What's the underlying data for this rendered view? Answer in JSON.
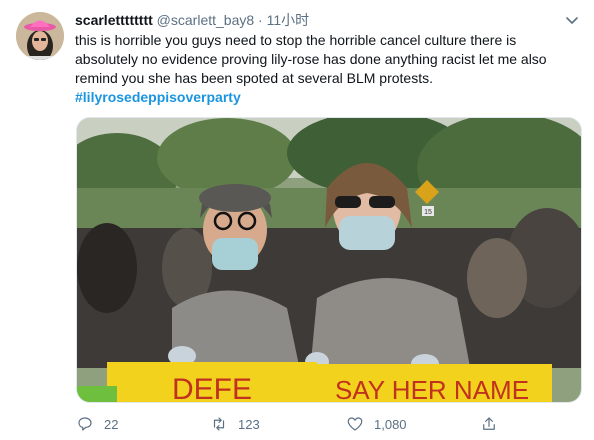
{
  "tweet": {
    "display_name": "scarletttttttt",
    "handle": "@scarlett_bay8",
    "separator": "·",
    "time": "11小时",
    "text": "this is horrible you guys need to stop the horrible cancel culture there is absolutely no evidence proving lily-rose has done anything racist let me also remind you she has been spoted at several BLM protests.",
    "hashtag": "#lilyrosedeppisoverparty"
  },
  "media": {
    "sign_left_text": "DEFE",
    "sign_right_text": "SAY HER NAME",
    "street_sign_text": "15"
  },
  "actions": {
    "reply_count": "22",
    "retweet_count": "123",
    "like_count": "1,080"
  },
  "colors": {
    "accent": "#1b95e0",
    "muted": "#5b7083",
    "sign_yellow": "#f2d21c"
  }
}
